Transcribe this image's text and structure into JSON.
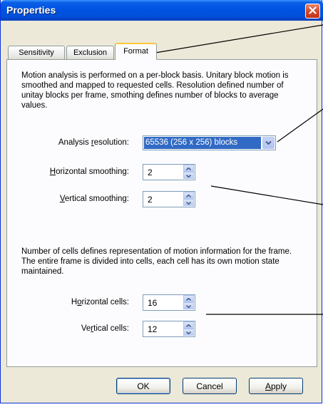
{
  "window": {
    "title": "Properties"
  },
  "tabs": [
    {
      "label": "Sensitivity"
    },
    {
      "label": "Exclusion"
    },
    {
      "label": "Format"
    }
  ],
  "format": {
    "description1": "Motion analysis is performed on a per-block basis. Unitary block motion is smoothed and mapped to requested cells. Resolution defined number of unitay blocks per frame, smothing defines number of blocks to average values.",
    "analysis_resolution": {
      "label_pre": "Analysis ",
      "label_key": "r",
      "label_post": "esolution:",
      "value": "65536 (256 x 256) blocks"
    },
    "horizontal_smoothing": {
      "label_pre": "",
      "label_key": "H",
      "label_post": "orizontal smoothing:",
      "value": "2"
    },
    "vertical_smoothing": {
      "label_pre": "",
      "label_key": "V",
      "label_post": "ertical smoothing:",
      "value": "2"
    },
    "description2": "Number of cells defines representation of motion information for the frame. The entire frame is divided into cells, each cell has its own motion state maintained.",
    "horizontal_cells": {
      "label_pre": "H",
      "label_key": "o",
      "label_post": "rizontal cells:",
      "value": "16"
    },
    "vertical_cells": {
      "label_pre": "Ve",
      "label_key": "r",
      "label_post": "tical cells:",
      "value": "12"
    }
  },
  "buttons": {
    "ok": "OK",
    "cancel": "Cancel",
    "apply_key": "A",
    "apply_rest": "pply"
  },
  "colors": {
    "titlebar": "#0054e3",
    "close": "#d2452a",
    "active_tab_accent": "#ffc73c",
    "selection": "#316ac5"
  }
}
